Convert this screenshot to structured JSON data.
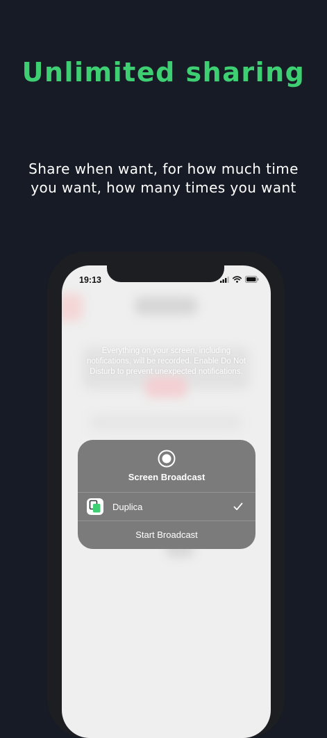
{
  "headline": "Unlimited sharing",
  "subtitle": "Share when want, for how much time you want, how many times you want",
  "status_bar": {
    "time": "19:13",
    "icons": [
      "signal-icon",
      "wifi-icon",
      "battery-icon"
    ]
  },
  "warning_text": "Everything on your screen, including notifications, will be recorded. Enable Do Not Disturb to prevent unexpected notifications.",
  "broadcast_sheet": {
    "title": "Screen Broadcast",
    "app_name": "Duplica",
    "selected": true,
    "start_label": "Start Broadcast"
  },
  "colors": {
    "background": "#171b26",
    "accent": "#3ecf73",
    "sheet": "#7b7b7b",
    "phone_frame": "#1d1e22"
  }
}
